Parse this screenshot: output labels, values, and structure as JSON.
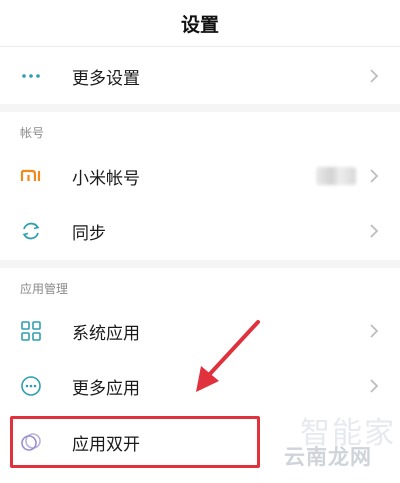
{
  "header": {
    "title": "设置"
  },
  "sections": {
    "account_header": "帐号",
    "app_mgmt_header": "应用管理"
  },
  "rows": {
    "more_settings": "更多设置",
    "mi_account": "小米帐号",
    "sync": "同步",
    "system_apps": "系统应用",
    "more_apps": "更多应用",
    "dual_apps": "应用双开"
  },
  "watermark": {
    "line1": "智能家",
    "line2": "云南龙网"
  },
  "colors": {
    "accent_teal": "#2f9fb0",
    "mi_orange": "#f08a1c",
    "highlight_red": "#e0313c",
    "chevron": "#bdbdbd"
  }
}
